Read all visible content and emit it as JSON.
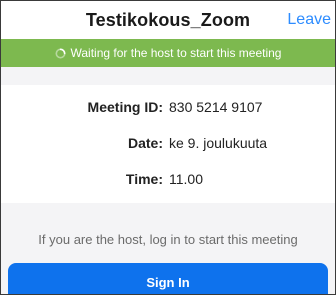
{
  "header": {
    "title": "Testikokous_Zoom",
    "leave_label": "Leave"
  },
  "banner": {
    "text": "Waiting for the host to start this meeting",
    "icon": "spinner-icon",
    "color": "#7db94f"
  },
  "details": {
    "meeting_id": {
      "label": "Meeting ID:",
      "value": "830 5214 9107"
    },
    "date": {
      "label": "Date:",
      "value": "ke 9. joulukuuta"
    },
    "time": {
      "label": "Time:",
      "value": "11.00"
    }
  },
  "host": {
    "message": "If you are the host, log in to start this meeting",
    "sign_in_label": "Sign In",
    "button_color": "#0e72ed"
  },
  "colors": {
    "accent": "#2d8cff"
  }
}
